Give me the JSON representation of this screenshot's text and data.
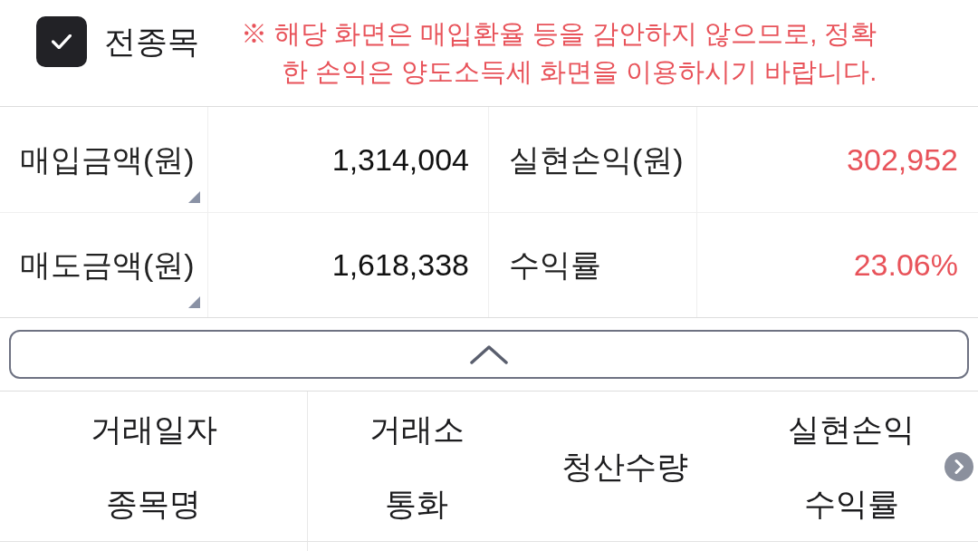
{
  "filter": {
    "label": "전종목",
    "checked": true
  },
  "notice": {
    "lines": [
      "※ 해당 화면은 매입환율 등을 감안하지 않으므로, 정확",
      "한 손익은 양도소득세 화면을 이용하시기 바랍니다."
    ]
  },
  "summary": [
    {
      "cells": [
        {
          "kind": "label",
          "text": "매입금액(원)",
          "corner_mark": true
        },
        {
          "kind": "amount",
          "text": "1,314,004"
        },
        {
          "kind": "label",
          "text": "실현손익(원)",
          "corner_mark": false
        },
        {
          "kind": "gain",
          "text": "302,952"
        }
      ]
    },
    {
      "cells": [
        {
          "kind": "label",
          "text": "매도금액(원)",
          "corner_mark": true
        },
        {
          "kind": "amount",
          "text": "1,618,338"
        },
        {
          "kind": "label",
          "text": "수익률",
          "corner_mark": false
        },
        {
          "kind": "gain",
          "text": "23.06%"
        }
      ]
    }
  ],
  "collapse_button": {
    "expanded": true
  },
  "columns": [
    {
      "labels": [
        "거래일자",
        "종목명"
      ]
    },
    {
      "labels": [
        "거래소",
        "통화"
      ]
    },
    {
      "labels": [
        "청산수량"
      ]
    },
    {
      "labels": [
        "실현손익",
        "수익률"
      ]
    }
  ]
}
